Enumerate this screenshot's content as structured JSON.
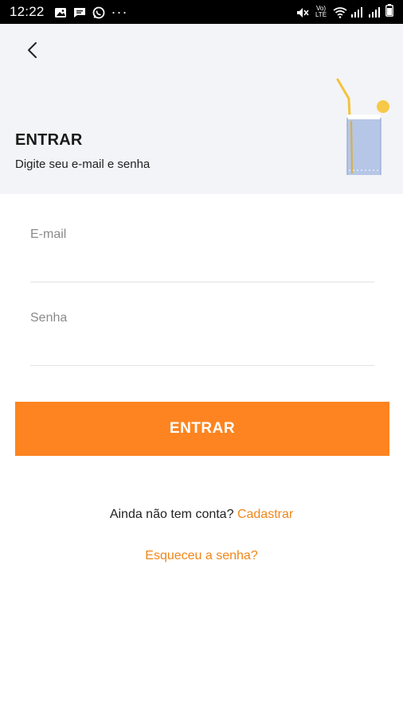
{
  "status_bar": {
    "time": "12:22",
    "more": "···",
    "network": "Vo) LTE"
  },
  "header": {
    "title": "ENTRAR",
    "subtitle": "Digite seu e-mail e senha"
  },
  "form": {
    "email_placeholder": "E-mail",
    "email_value": "",
    "password_placeholder": "Senha",
    "password_value": "",
    "submit_label": "ENTRAR"
  },
  "footer": {
    "signup_prompt": "Ainda não tem conta?",
    "signup_link": "Cadastrar",
    "forgot_link": "Esqueceu a senha?"
  },
  "colors": {
    "accent": "#fd8420",
    "link": "#f0861a",
    "header_bg": "#f3f4f8"
  },
  "icons": [
    "image-icon",
    "message-icon",
    "whatsapp-icon",
    "mute-icon",
    "wifi-icon",
    "signal-icon",
    "battery-icon",
    "back-arrow-icon",
    "drink-glass-icon"
  ]
}
